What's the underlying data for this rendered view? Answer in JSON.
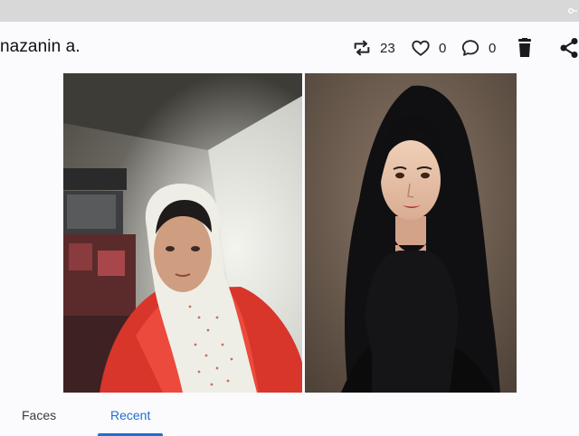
{
  "header": {
    "user_name": "nazanin a.",
    "actions": [
      {
        "icon": "repost-icon",
        "count": "23"
      },
      {
        "icon": "heart-icon",
        "count": "0"
      },
      {
        "icon": "comment-icon",
        "count": "0"
      },
      {
        "icon": "trash-icon"
      },
      {
        "icon": "share-icon"
      }
    ]
  },
  "photos": [
    {
      "name": "original-photo"
    },
    {
      "name": "generated-portrait"
    }
  ],
  "tabs": [
    {
      "label": "Faces",
      "active": false
    },
    {
      "label": "Recent",
      "active": true
    }
  ],
  "colors": {
    "accent": "#1f6fcf",
    "text": "#111111",
    "top_strip": "#d8d8d8"
  }
}
